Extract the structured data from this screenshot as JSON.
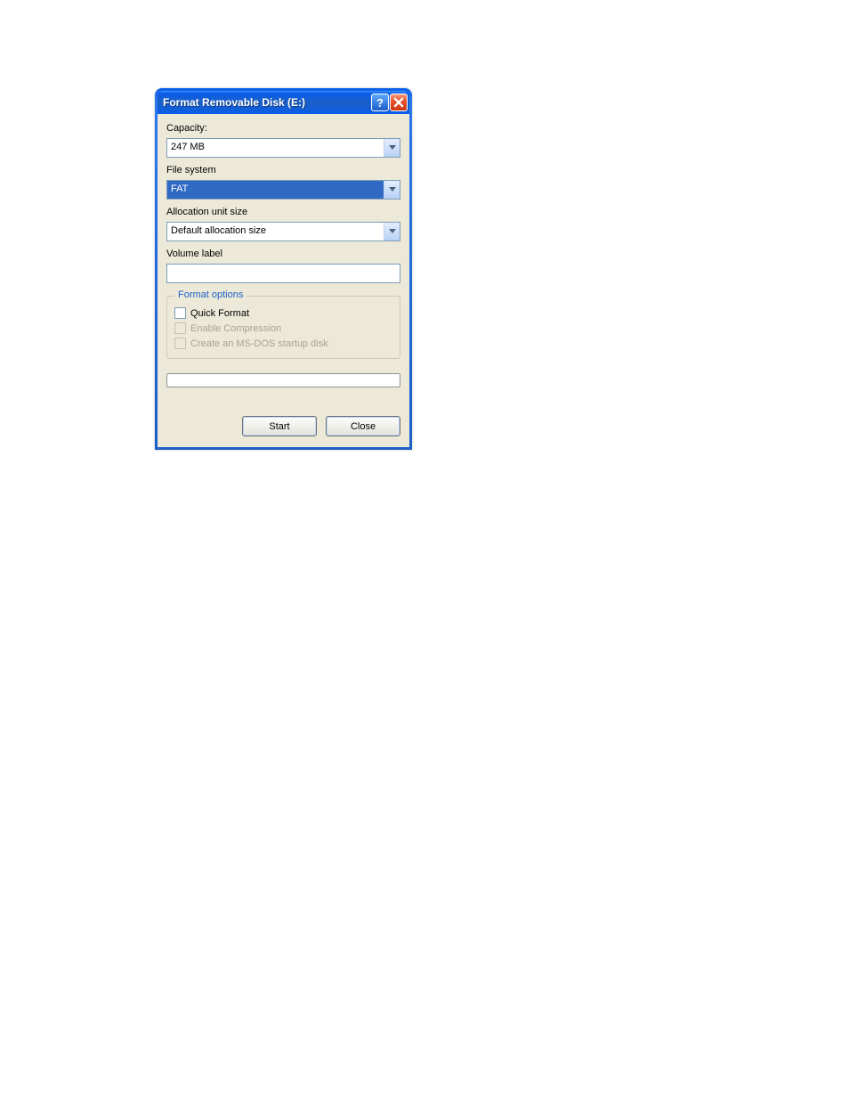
{
  "window": {
    "title": "Format Removable Disk (E:)"
  },
  "labels": {
    "capacity": "Capacity:",
    "filesystem": "File system",
    "allocation": "Allocation unit size",
    "volume": "Volume label",
    "format_options": "Format options"
  },
  "fields": {
    "capacity_value": "247 MB",
    "filesystem_value": "FAT",
    "allocation_value": "Default allocation size",
    "volume_value": ""
  },
  "options": {
    "quick_format": "Quick Format",
    "enable_compression": "Enable Compression",
    "msdos_startup": "Create an MS-DOS startup disk"
  },
  "buttons": {
    "start": "Start",
    "close": "Close"
  }
}
